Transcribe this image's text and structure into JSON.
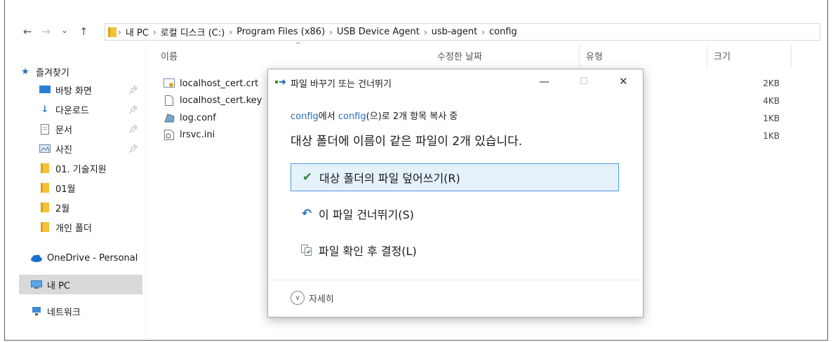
{
  "breadcrumb": [
    "내 PC",
    "로컬 디스크 (C:)",
    "Program Files (x86)",
    "USB Device Agent",
    "usb-agent",
    "config"
  ],
  "nav": {
    "back": "←",
    "forward": "→",
    "recent": "⌄",
    "up": "↑"
  },
  "sidebar": {
    "items": [
      {
        "label": "즐겨찾기",
        "icon": "star-icon",
        "pinned": false
      },
      {
        "label": "바탕 화면",
        "icon": "desktop-icon",
        "pinned": true
      },
      {
        "label": "다운로드",
        "icon": "download-icon",
        "pinned": true
      },
      {
        "label": "문서",
        "icon": "document-icon",
        "pinned": true
      },
      {
        "label": "사진",
        "icon": "pictures-icon",
        "pinned": true
      },
      {
        "label": "01. 기술지원",
        "icon": "folder-icon",
        "pinned": false
      },
      {
        "label": "01월",
        "icon": "folder-icon",
        "pinned": false
      },
      {
        "label": "2월",
        "icon": "folder-icon",
        "pinned": false
      },
      {
        "label": "개인 폴더",
        "icon": "folder-icon",
        "pinned": false
      },
      {
        "label": "OneDrive - Personal",
        "icon": "cloud-icon",
        "pinned": false
      },
      {
        "label": "내 PC",
        "icon": "computer-icon",
        "pinned": false,
        "selected": true
      },
      {
        "label": "네트워크",
        "icon": "network-icon",
        "pinned": false
      }
    ]
  },
  "columns": {
    "name": "이름",
    "modified": "수정한 날짜",
    "type": "유형",
    "size": "크기"
  },
  "files": [
    {
      "name": "localhost_cert.crt",
      "icon": "certificate-icon",
      "size": "2KB"
    },
    {
      "name": "localhost_cert.key",
      "icon": "file-icon",
      "size": "4KB"
    },
    {
      "name": "log.conf",
      "icon": "config-file-icon",
      "size": "1KB"
    },
    {
      "name": "lrsvc.ini",
      "icon": "settings-file-icon",
      "size": "1KB"
    }
  ],
  "dialog": {
    "title": "파일 바꾸기 또는 건너뛰기",
    "controls": {
      "minimize": "—",
      "maximize": "☐",
      "close": "✕"
    },
    "sub_src": "config",
    "sub_mid": "에서 ",
    "sub_dst": "config",
    "sub_tail": "(으)로 2개 항목 복사 중",
    "heading": "대상 폴더에 이름이 같은 파일이 2개 있습니다.",
    "options": [
      {
        "label": "대상 폴더의 파일 덮어쓰기(R)",
        "icon": "checkmark-icon",
        "selected": true
      },
      {
        "label": "이 파일 건너뛰기(S)",
        "icon": "skip-icon",
        "selected": false
      },
      {
        "label": "파일 확인 후 결정(L)",
        "icon": "compare-files-icon",
        "selected": false
      }
    ],
    "details": "자세히"
  },
  "colors": {
    "accent": "#2a6ebb",
    "selected_bg": "#e5f1fb",
    "selected_border": "#4b9ae0",
    "folder": "#f3c13a"
  }
}
